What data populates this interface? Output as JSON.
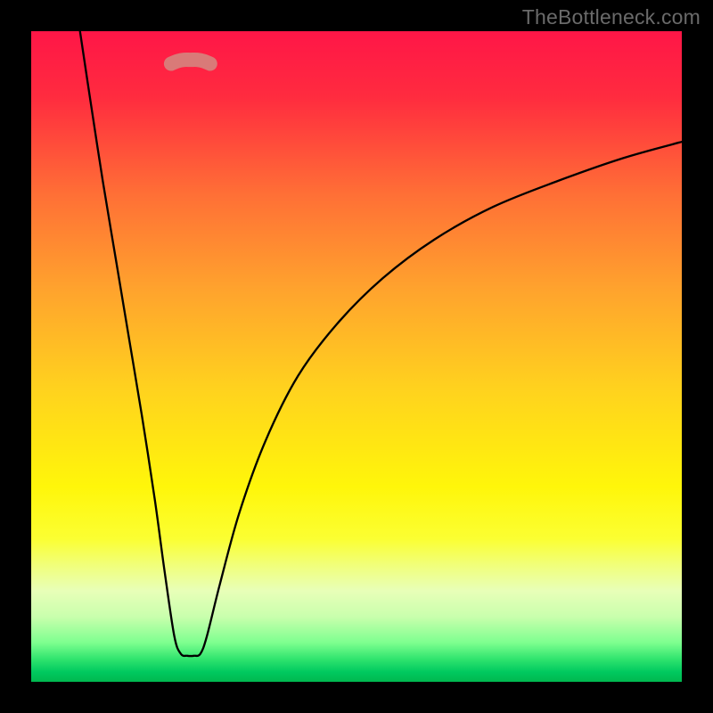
{
  "watermark": "TheBottleneck.com",
  "gradient": {
    "stops": [
      {
        "offset": 0.0,
        "color": "#ff1647"
      },
      {
        "offset": 0.1,
        "color": "#ff2b3f"
      },
      {
        "offset": 0.25,
        "color": "#ff6f36"
      },
      {
        "offset": 0.4,
        "color": "#ffa42d"
      },
      {
        "offset": 0.55,
        "color": "#ffd21e"
      },
      {
        "offset": 0.7,
        "color": "#fff60a"
      },
      {
        "offset": 0.78,
        "color": "#fbff32"
      },
      {
        "offset": 0.82,
        "color": "#f1ff79"
      },
      {
        "offset": 0.86,
        "color": "#e8ffb8"
      },
      {
        "offset": 0.9,
        "color": "#c9ffad"
      },
      {
        "offset": 0.94,
        "color": "#7dff8f"
      },
      {
        "offset": 0.965,
        "color": "#30e46e"
      },
      {
        "offset": 0.985,
        "color": "#00c95f"
      },
      {
        "offset": 1.0,
        "color": "#00b84f"
      }
    ]
  },
  "chart_data": {
    "type": "line",
    "title": "",
    "xlabel": "",
    "ylabel": "",
    "xlim": [
      0,
      100
    ],
    "ylim": [
      0,
      100
    ],
    "x_of_min": 24,
    "floor_start_x": 22,
    "floor_end_x": 27,
    "floor_y": 95,
    "curve_notes": "V-shaped bottleneck curve; y is mismatch percentage (higher = worse). Minimum ~0 near x≈24. Left branch rises steeply to y≈100 by x≈7; right branch rises with diminishing slope toward y≈83 at x=100.",
    "series": [
      {
        "name": "bottleneck-curve",
        "x": [
          7.5,
          9,
          11,
          13,
          15,
          17,
          19,
          20.5,
          22,
          23,
          24,
          25,
          26,
          27,
          29,
          32,
          36,
          41,
          47,
          54,
          62,
          71,
          81,
          91,
          100
        ],
        "y": [
          100,
          90,
          77,
          65,
          53,
          41,
          28,
          17,
          7,
          4.3,
          4.0,
          4.0,
          4.3,
          7,
          15,
          26,
          37,
          47,
          55,
          62,
          68,
          73,
          77,
          80.5,
          83
        ]
      }
    ],
    "flat_segment": {
      "x": [
        21.5,
        22.5,
        23.5,
        24.5,
        25.5,
        26.5,
        27.5
      ],
      "y": [
        95,
        95.4,
        95.6,
        95.6,
        95.6,
        95.4,
        95
      ],
      "color": "#d97a78",
      "stroke_width_px": 14
    }
  }
}
